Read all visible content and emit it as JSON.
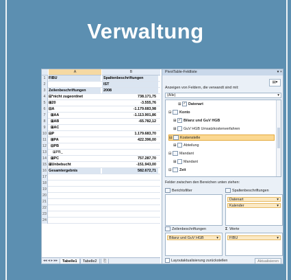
{
  "slide": {
    "title": "Verwaltung"
  },
  "sheet": {
    "col_a": "A",
    "col_b": "B",
    "rows": [
      {
        "n": "1",
        "a": "FIBU",
        "b": "Spaltenbeschriftungen",
        "bold": true,
        "shade": true,
        "bleft": true
      },
      {
        "n": "2",
        "a": "",
        "b": "IST",
        "bold": true,
        "shade": true,
        "bleft": true
      },
      {
        "n": "3",
        "a": "Zeilenbeschriftungen",
        "b": "2008",
        "bold": true,
        "shade": true,
        "bleft": true
      },
      {
        "n": "4",
        "a": "⊟*nicht zugeordnet",
        "b": "738.171,75",
        "bold": true
      },
      {
        "n": "5",
        "a": "⊞20",
        "b": "-3.555,76",
        "bold": true
      },
      {
        "n": "6",
        "a": "⊟A",
        "b": "-1.179.683,98",
        "bold": true
      },
      {
        "n": "7",
        "a": "  ⊞AA",
        "b": "-1.113.901,86",
        "bold": true
      },
      {
        "n": "8",
        "a": "  ⊞AB",
        "b": "-65.782,12",
        "bold": true
      },
      {
        "n": "9",
        "a": "  ⊞AC",
        "b": "",
        "bold": true
      },
      {
        "n": "10",
        "a": "⊟P",
        "b": "1.179.683,70",
        "bold": true
      },
      {
        "n": "11",
        "a": "  ⊞PA",
        "b": "422.396,00",
        "bold": true
      },
      {
        "n": "12",
        "a": "  ⊟PB",
        "b": "",
        "bold": true
      },
      {
        "n": "13",
        "a": "    ⊞PB_",
        "b": "",
        "bold": false
      },
      {
        "n": "14",
        "a": "  ⊞PC",
        "b": "757.287,70",
        "bold": true
      },
      {
        "n": "15",
        "a": "⊞Unbebucht",
        "b": "-151.943,00",
        "bold": true
      },
      {
        "n": "16",
        "a": "Gesamtergebnis",
        "b": "582.672,71",
        "bold": true,
        "shade": true
      },
      {
        "n": "17",
        "a": "",
        "b": ""
      },
      {
        "n": "18",
        "a": "",
        "b": ""
      },
      {
        "n": "19",
        "a": "",
        "b": ""
      },
      {
        "n": "20",
        "a": "",
        "b": ""
      },
      {
        "n": "21",
        "a": "",
        "b": ""
      },
      {
        "n": "22",
        "a": "",
        "b": ""
      },
      {
        "n": "23",
        "a": "",
        "b": ""
      },
      {
        "n": "24",
        "a": "",
        "b": ""
      }
    ],
    "tabs": [
      "Tabelle1",
      "Tabelle2"
    ]
  },
  "pivot": {
    "title": "PivotTable-Feldliste",
    "close": "▾ ×",
    "prompt": "Anzeigen von Feldern, die verwandt sind mit:",
    "filter_value": "(Alle)",
    "fields": [
      {
        "label": "Datenart",
        "checked": true,
        "indent": 2,
        "bold": true,
        "group": false
      },
      {
        "label": "Konto",
        "checked": false,
        "indent": 0,
        "bold": true,
        "group": true
      },
      {
        "label": "Bilanz und GuV HGB",
        "checked": true,
        "indent": 1,
        "bold": true,
        "group": false
      },
      {
        "label": "GuV HGB Umsatzkostenverfahren",
        "checked": false,
        "indent": 1,
        "bold": false,
        "group": false
      },
      {
        "label": "Kostenstelle",
        "checked": false,
        "indent": 0,
        "bold": false,
        "group": true,
        "highlight": true
      },
      {
        "label": "Abteilung",
        "checked": false,
        "indent": 1,
        "bold": false,
        "group": false
      },
      {
        "label": "Mandant",
        "checked": false,
        "indent": 0,
        "bold": false,
        "group": true
      },
      {
        "label": "Mandant",
        "checked": false,
        "indent": 1,
        "bold": false,
        "group": false
      },
      {
        "label": "Zeit",
        "checked": false,
        "indent": 0,
        "bold": true,
        "group": true
      }
    ],
    "areas_prompt": "Felder zwischen den Bereichen unten ziehen:",
    "report_filter": "Berichtsfilter",
    "column_labels": "Spaltenbeschriftungen",
    "column_chips": [
      "Datenart",
      "Kalender"
    ],
    "row_labels": "Zeilenbeschriftungen",
    "row_chips": [
      "Bilanz und GuV HGB"
    ],
    "values": "Werte",
    "value_chips": [
      "FIBU"
    ],
    "defer": "Layoutaktualisierung zurückstellen",
    "update": "Aktualisieren"
  }
}
